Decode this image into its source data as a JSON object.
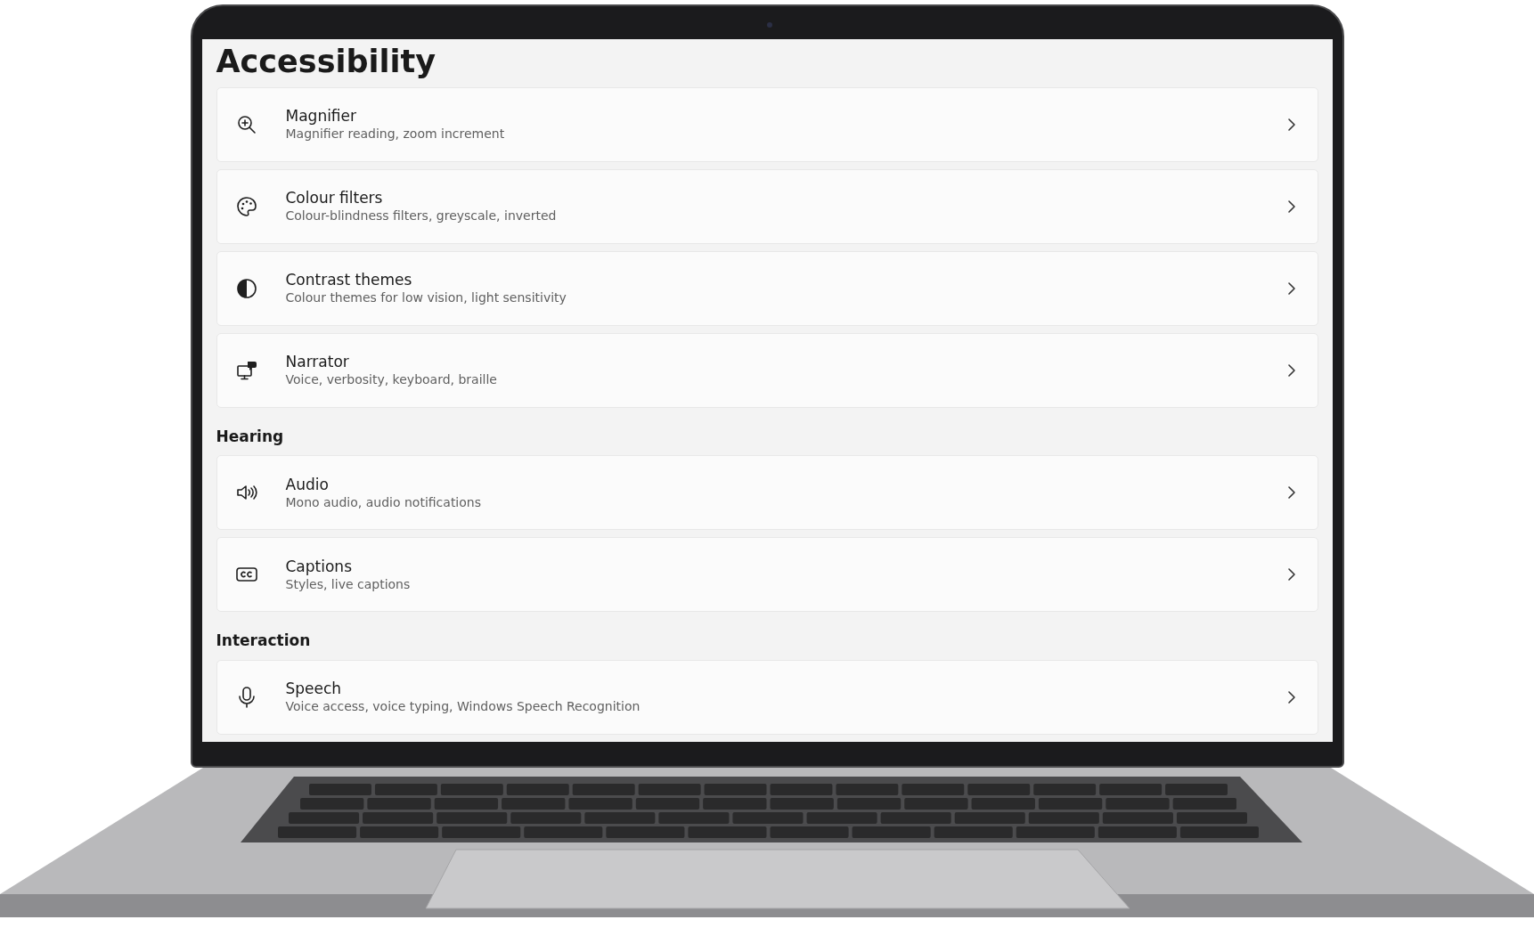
{
  "page_title": "Accessibility",
  "sections": [
    {
      "items": [
        {
          "kind": "magnifier",
          "title": "Magnifier",
          "subtitle": "Magnifier reading, zoom increment"
        },
        {
          "kind": "palette",
          "title": "Colour filters",
          "subtitle": "Colour-blindness filters, greyscale, inverted"
        },
        {
          "kind": "contrast",
          "title": "Contrast themes",
          "subtitle": "Colour themes for low vision, light sensitivity"
        },
        {
          "kind": "narrator",
          "title": "Narrator",
          "subtitle": "Voice, verbosity, keyboard, braille"
        }
      ]
    },
    {
      "heading": "Hearing",
      "items": [
        {
          "kind": "speaker",
          "title": "Audio",
          "subtitle": "Mono audio, audio notifications"
        },
        {
          "kind": "captions",
          "title": "Captions",
          "subtitle": "Styles, live captions"
        }
      ]
    },
    {
      "heading": "Interaction",
      "items": [
        {
          "kind": "microphone",
          "title": "Speech",
          "subtitle": "Voice access, voice typing, Windows Speech Recognition"
        }
      ]
    }
  ]
}
